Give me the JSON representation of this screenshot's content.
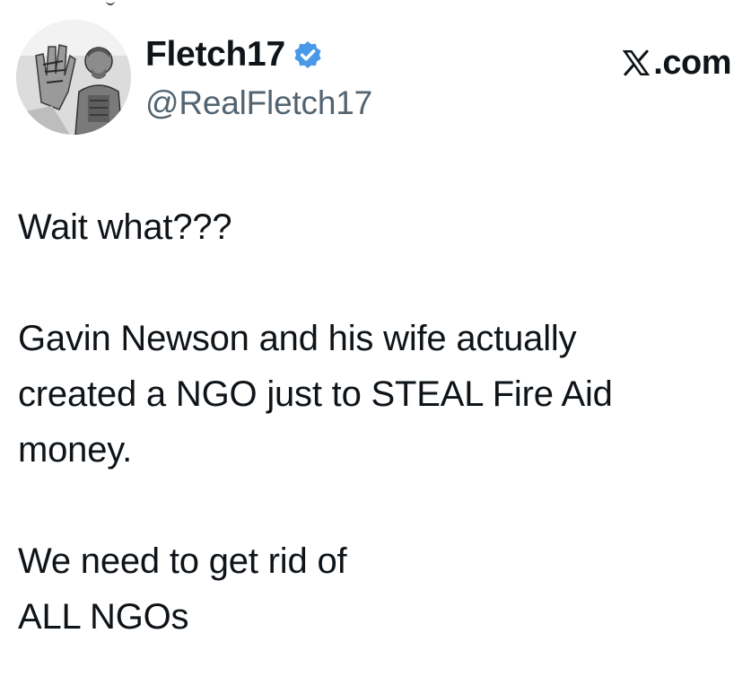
{
  "author": {
    "display_name": "Fletch17",
    "handle": "@RealFletch17",
    "verified": true,
    "verified_color": "#4a99e9"
  },
  "brand": {
    "icon": "x-logo-icon",
    "text": ".com"
  },
  "post": {
    "line1": "Wait what???",
    "para2_line1": "Gavin Newson and his wife actually",
    "para2_line2": "created a NGO just to STEAL Fire Aid",
    "para2_line3": "money.",
    "para3_line1": "We need to get rid of",
    "para3_line2": "ALL NGOs"
  },
  "colors": {
    "text": "#0f1419",
    "secondary": "#536471",
    "background": "#ffffff"
  }
}
